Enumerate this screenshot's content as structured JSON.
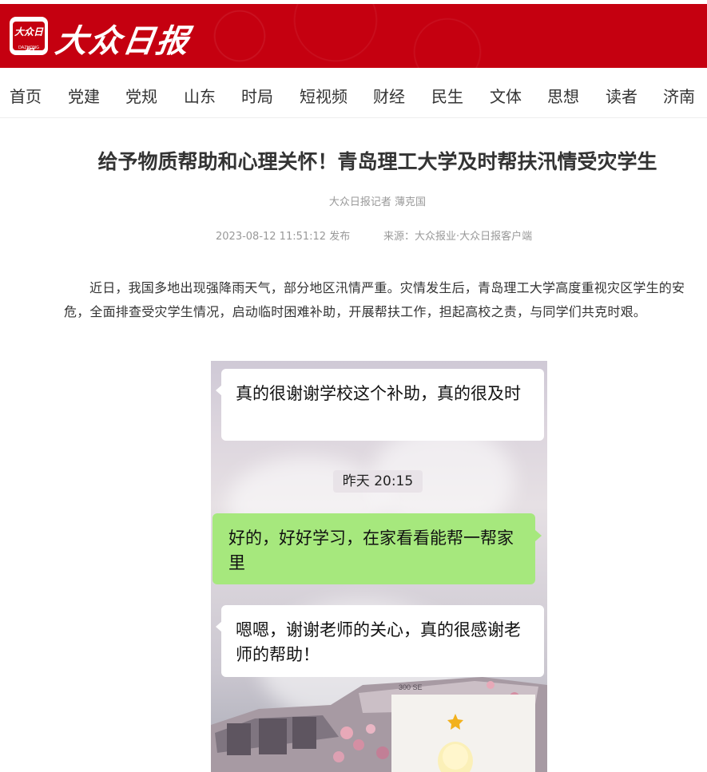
{
  "brand": {
    "logo_name": "大众日报",
    "logo_sub": "DAZHONG",
    "logo_icon": "dazhong-logo-icon"
  },
  "nav": {
    "items": [
      "首页",
      "党建",
      "党规",
      "山东",
      "时局",
      "短视频",
      "财经",
      "民生",
      "文体",
      "思想",
      "读者",
      "济南"
    ]
  },
  "article": {
    "title": "给予物质帮助和心理关怀！青岛理工大学及时帮扶汛情受灾学生",
    "byline": "大众日报记者 薄克国",
    "published": "2023-08-12 11:51:12 发布",
    "source": "来源：大众报业·大众日报客户端",
    "paragraph": "近日，我国多地出现强降雨天气，部分地区汛情严重。灾情发生后，青岛理工大学高度重视灾区学生的安危，全面排查受灾学生情况，启动临时困难补助，开展帮扶工作，担起高校之责，与同学们共克时艰。"
  },
  "chat_image": {
    "messages": [
      {
        "side": "left",
        "text": "真的很谢谢学校这个补助，真的很及时"
      },
      {
        "side": "right",
        "text": "好的，好好学习，在家看看能帮一帮家里"
      },
      {
        "side": "left",
        "text": "嗯嗯，谢谢老师的关心，真的很感谢老师的帮助！"
      }
    ],
    "timestamp": "昨天 20:15",
    "car_badge": "300 SE"
  },
  "colors": {
    "brand_red": "#c50010",
    "bubble_green": "#a6e87d"
  }
}
